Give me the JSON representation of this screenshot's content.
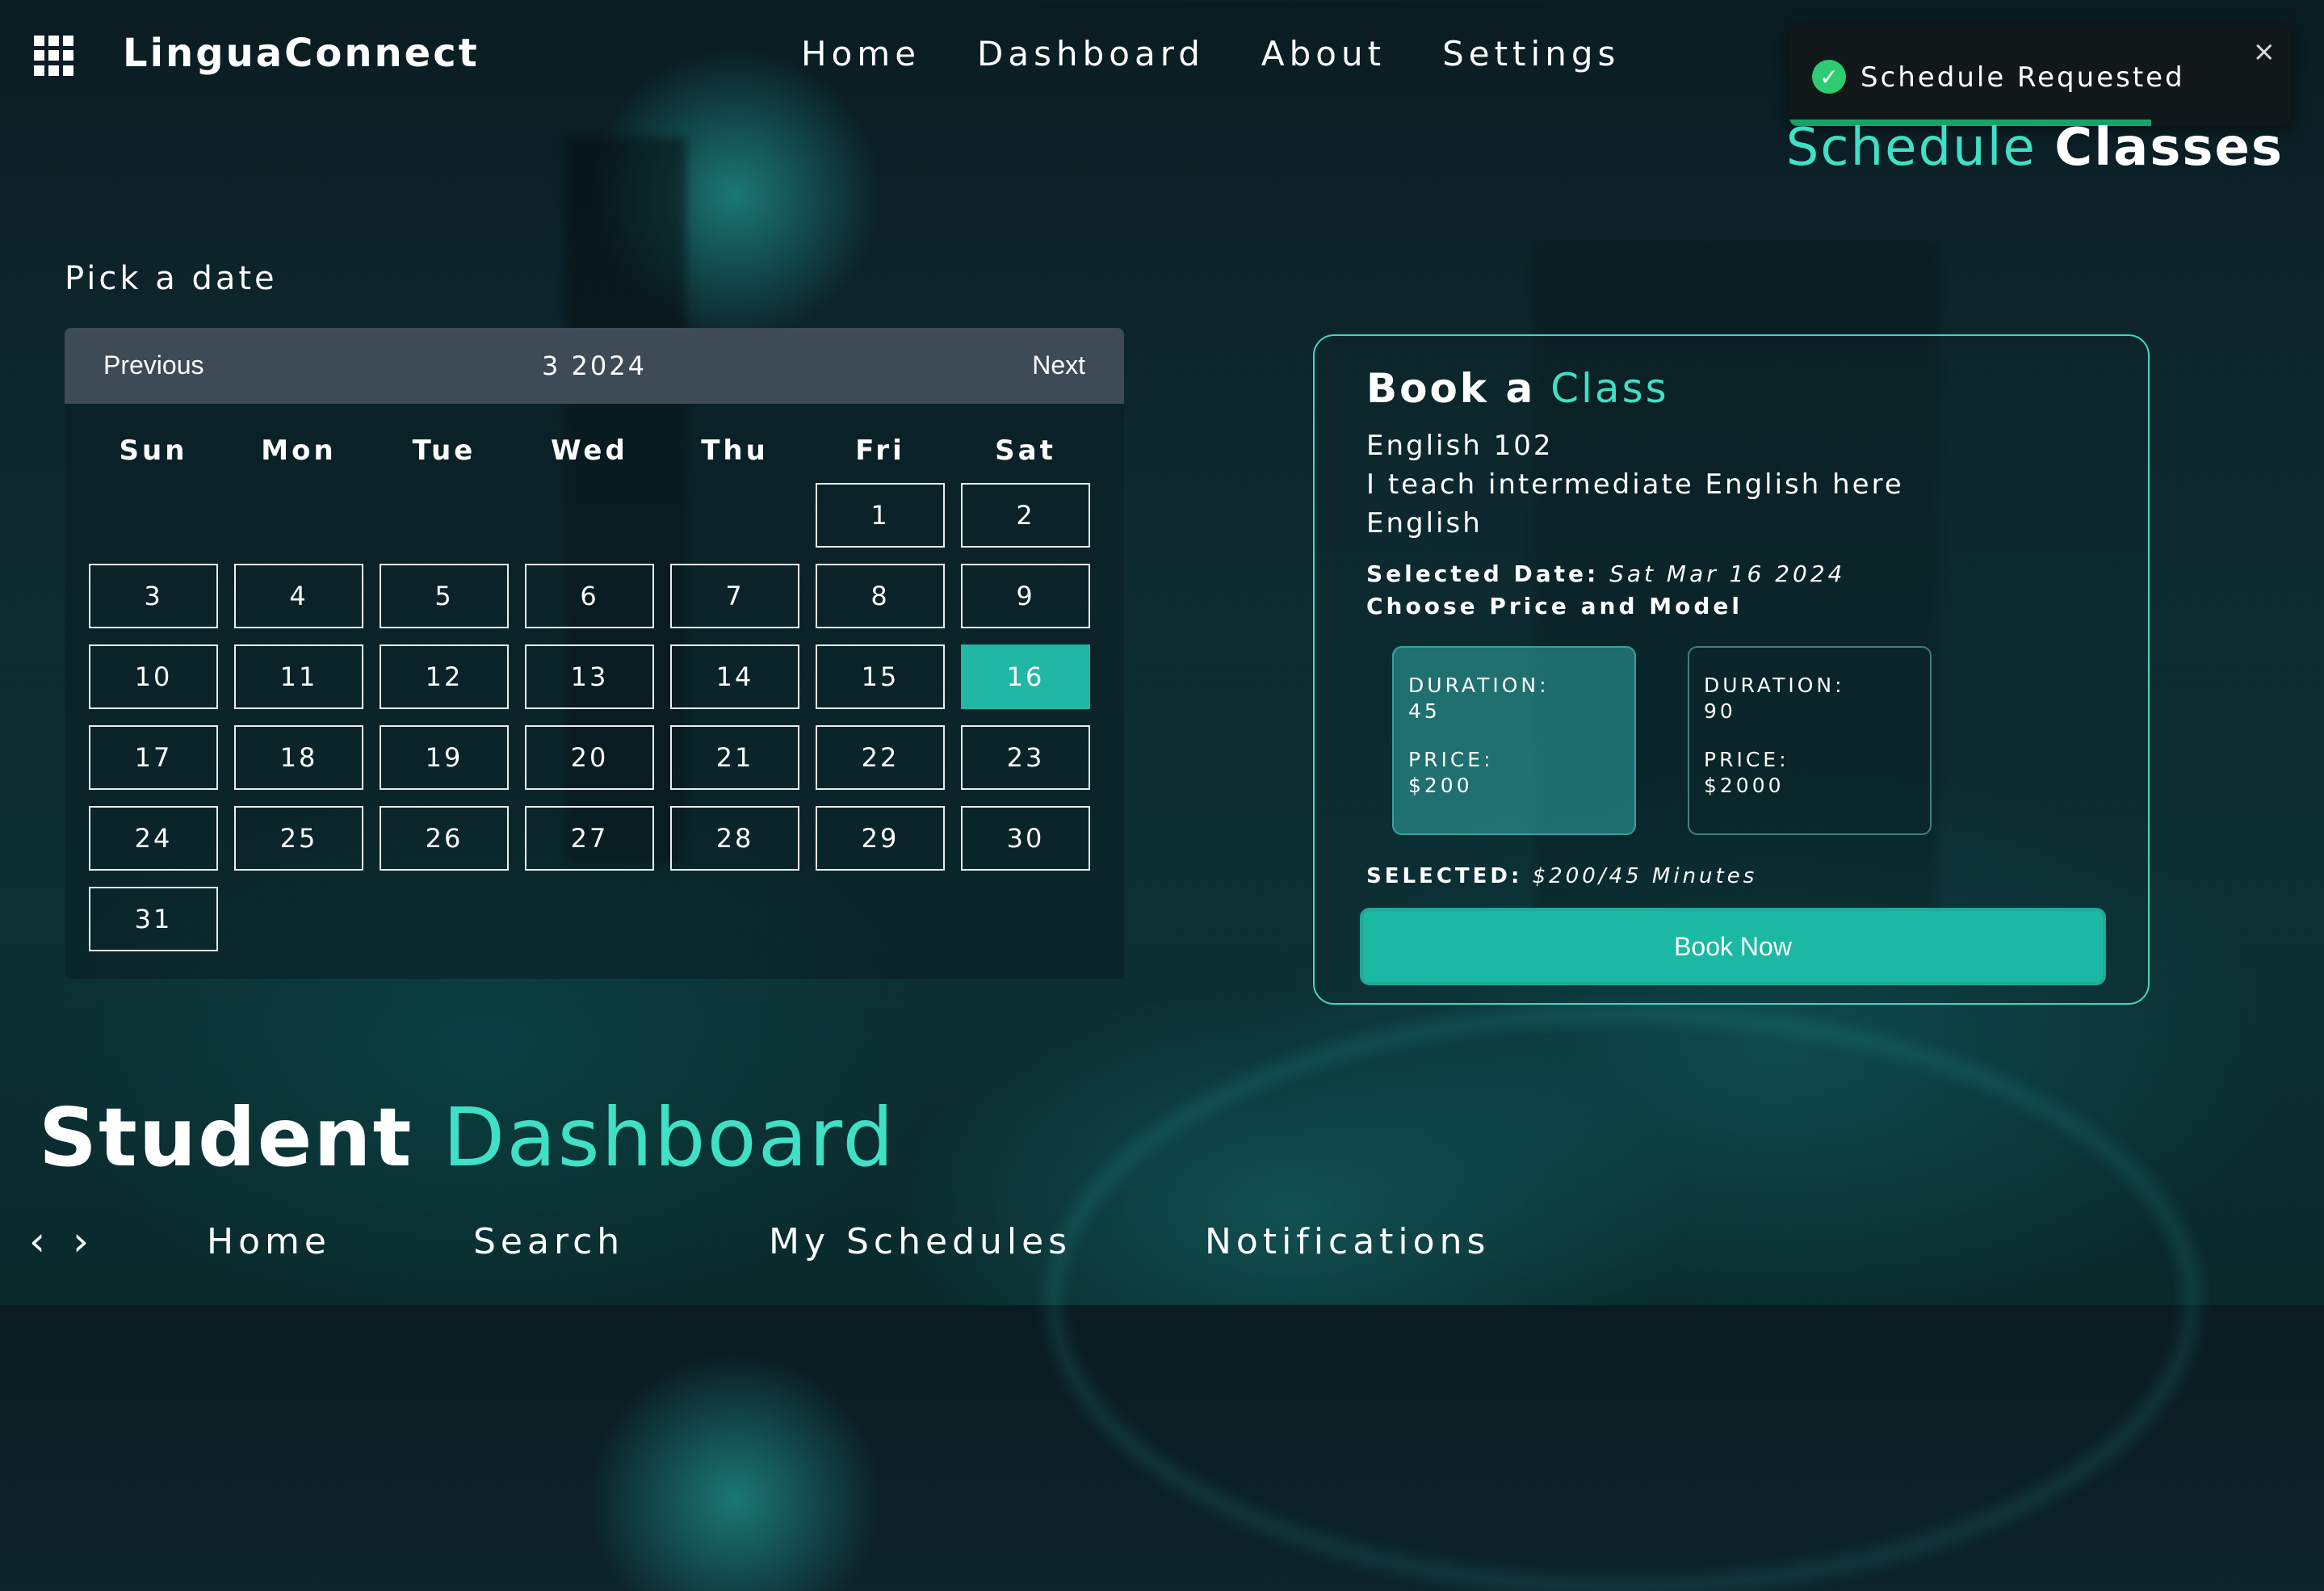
{
  "brand": {
    "name": "LinguaConnect",
    "menu_icon": "grid-icon"
  },
  "top_nav": [
    "Home",
    "Dashboard",
    "About",
    "Settings"
  ],
  "toast": {
    "message": "Schedule Requested",
    "close": "×",
    "icon": "check-circle-icon",
    "progress": 0.72,
    "color": "#16a36a"
  },
  "schedule_heading": {
    "accent": "Schedule",
    "strong": "Classes"
  },
  "calendar": {
    "label": "Pick a date",
    "prev_label": "Previous",
    "next_label": "Next",
    "month": "3 2024",
    "weekdays": [
      "Sun",
      "Mon",
      "Tue",
      "Wed",
      "Thu",
      "Fri",
      "Sat"
    ],
    "first_weekday": 5,
    "days_in_month": 31,
    "selected_day": 16,
    "selected_color": "#20b8a5"
  },
  "booking": {
    "title_strong": "Book a",
    "title_accent": "Class",
    "course_code": "English 102",
    "description": "I teach intermediate English here",
    "language": "English",
    "selected_date_label": "Selected Date:",
    "selected_date_value": "Sat Mar 16 2024",
    "choose_label": "Choose Price and Model",
    "options": [
      {
        "duration_label": "DURATION:",
        "duration": "45",
        "price_label": "PRICE:",
        "price": "$200",
        "active": true
      },
      {
        "duration_label": "DURATION:",
        "duration": "90",
        "price_label": "PRICE:",
        "price": "$2000",
        "active": false
      }
    ],
    "selected_label": "SELECTED:",
    "selected_value": "$200/45 Minutes",
    "book_button": "Book Now",
    "accent_color": "#3fe0c5"
  },
  "dashboard_title": {
    "strong": "Student",
    "accent": "Dashboard"
  },
  "bottom_nav": {
    "back_icon": "chevron-left-icon",
    "forward_icon": "chevron-right-icon",
    "items": [
      "Home",
      "Search",
      "My Schedules",
      "Notifications"
    ]
  }
}
